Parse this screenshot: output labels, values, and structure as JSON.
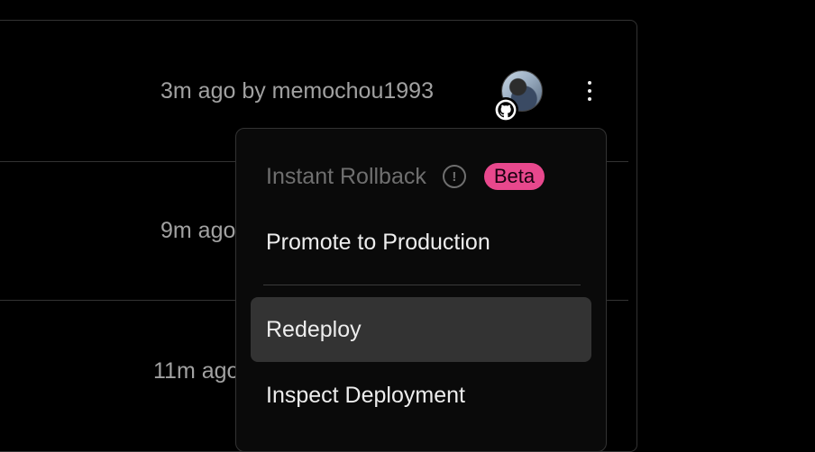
{
  "rows": [
    {
      "meta": "3m ago by memochou1993"
    },
    {
      "meta": "9m ago"
    },
    {
      "meta": "11m ago"
    }
  ],
  "avatar": {
    "icon": "github-icon"
  },
  "menu": {
    "instant_rollback": "Instant Rollback",
    "info_glyph": "!",
    "beta_badge": "Beta",
    "promote": "Promote to Production",
    "redeploy": "Redeploy",
    "inspect": "Inspect Deployment"
  },
  "colors": {
    "background": "#000000",
    "menu_bg": "#0a0a0a",
    "highlight": "#333333",
    "beta_badge": "#e8488d",
    "muted_text": "#a1a1a1"
  }
}
